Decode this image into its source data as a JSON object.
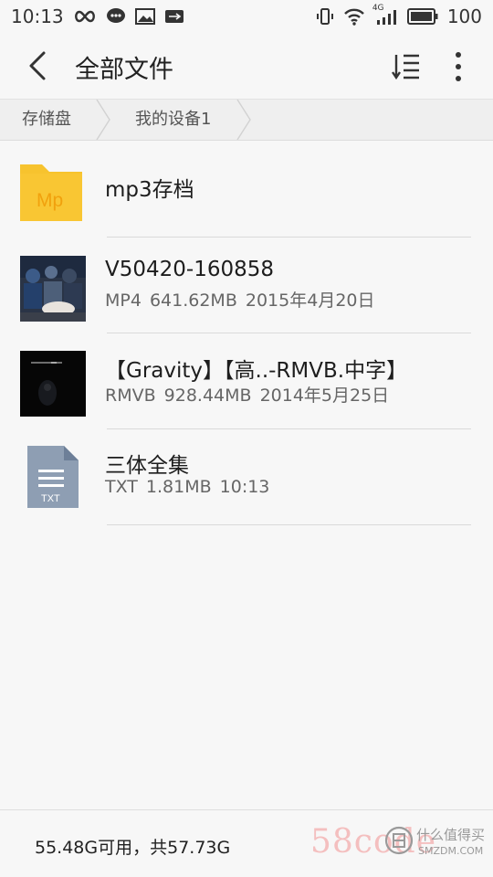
{
  "status_bar": {
    "time": "10:13",
    "network_type": "4G",
    "battery": "100",
    "left_icons": [
      "infinity-icon",
      "chat-icon",
      "image-icon",
      "usb-icon"
    ],
    "right_icons": [
      "vibrate-icon",
      "wifi-icon",
      "signal-icon",
      "battery-icon"
    ]
  },
  "header": {
    "title": "全部文件",
    "back_icon": "back-arrow-icon",
    "sort_icon": "sort-icon",
    "more_icon": "more-vertical-icon"
  },
  "breadcrumb": {
    "items": [
      "存储盘",
      "我的设备1"
    ]
  },
  "files": [
    {
      "name": "mp3存档",
      "type": "folder",
      "icon_label": "Mp",
      "meta_type": "",
      "meta_size": "",
      "meta_date": ""
    },
    {
      "name": "V50420-160858",
      "type": "video",
      "meta_type": "MP4",
      "meta_size": "641.62MB",
      "meta_date": "2015年4月20日"
    },
    {
      "name": "【Gravity】【高..-RMVB.中字】",
      "type": "video",
      "meta_type": "RMVB",
      "meta_size": "928.44MB",
      "meta_date": "2014年5月25日"
    },
    {
      "name": "三体全集",
      "type": "text",
      "icon_label": "TXT",
      "meta_type": "TXT",
      "meta_size": "1.81MB",
      "meta_date": "10:13"
    }
  ],
  "footer": {
    "storage": "55.48G可用，共57.73G"
  },
  "watermark": {
    "brand": "58code",
    "slogan": "什么值得买",
    "site": "SMZDM.COM"
  },
  "colors": {
    "folder": "#f7c32e",
    "folder_label": "#f1a10d",
    "txt_icon": "#8e9eb3",
    "background": "#f7f7f7"
  }
}
